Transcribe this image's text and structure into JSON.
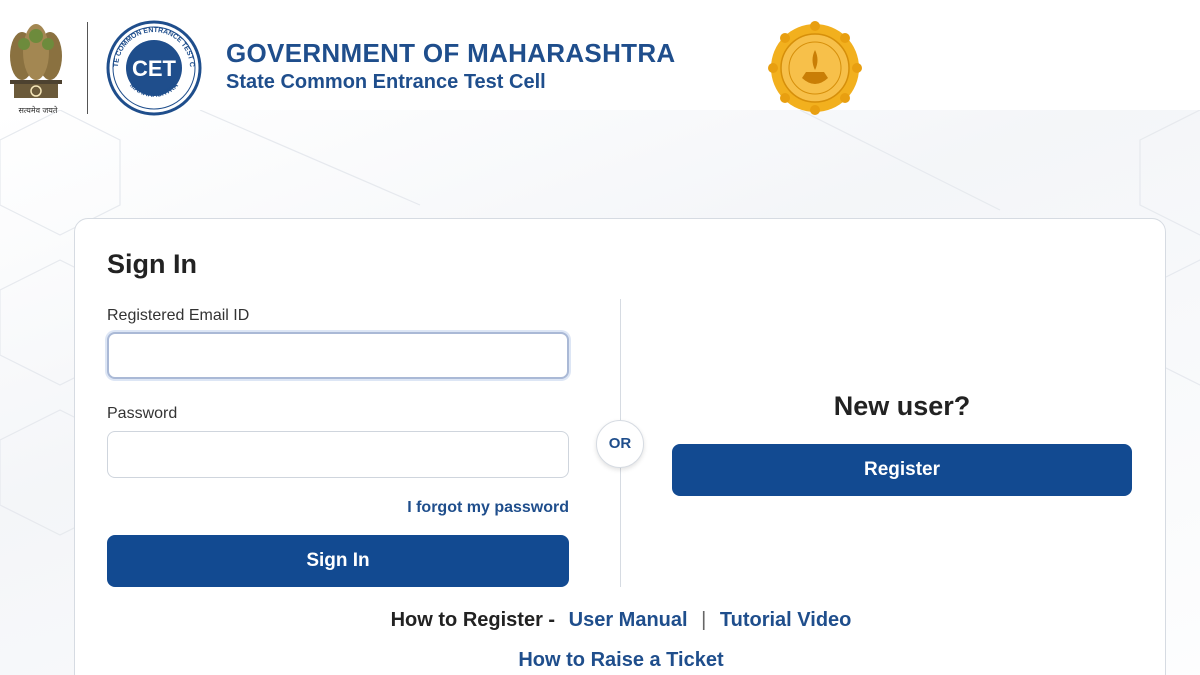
{
  "header": {
    "emblem_caption": "सत्यमेव जयते",
    "cet_logo": {
      "ring_top": "STATE COMMON ENTRANCE TEST CELL",
      "ring_bottom": "MAHARASHTRA",
      "center": "CET"
    },
    "title": "GOVERNMENT OF MAHARASHTRA",
    "subtitle": "State Common Entrance Test Cell"
  },
  "signin": {
    "heading": "Sign In",
    "email_label": "Registered Email ID",
    "email_value": "",
    "password_label": "Password",
    "password_value": "",
    "forgot_link": "I forgot my password",
    "button": "Sign In"
  },
  "divider": {
    "or_label": "OR"
  },
  "register": {
    "heading": "New user?",
    "button": "Register"
  },
  "help": {
    "how_to_register": "How to Register -",
    "user_manual": "User Manual",
    "separator": "|",
    "tutorial_video": "Tutorial Video",
    "raise_ticket": "How to Raise a Ticket"
  },
  "colors": {
    "primary": "#124a91",
    "link": "#1f4e8c",
    "seal_gold": "#f2b01e"
  }
}
